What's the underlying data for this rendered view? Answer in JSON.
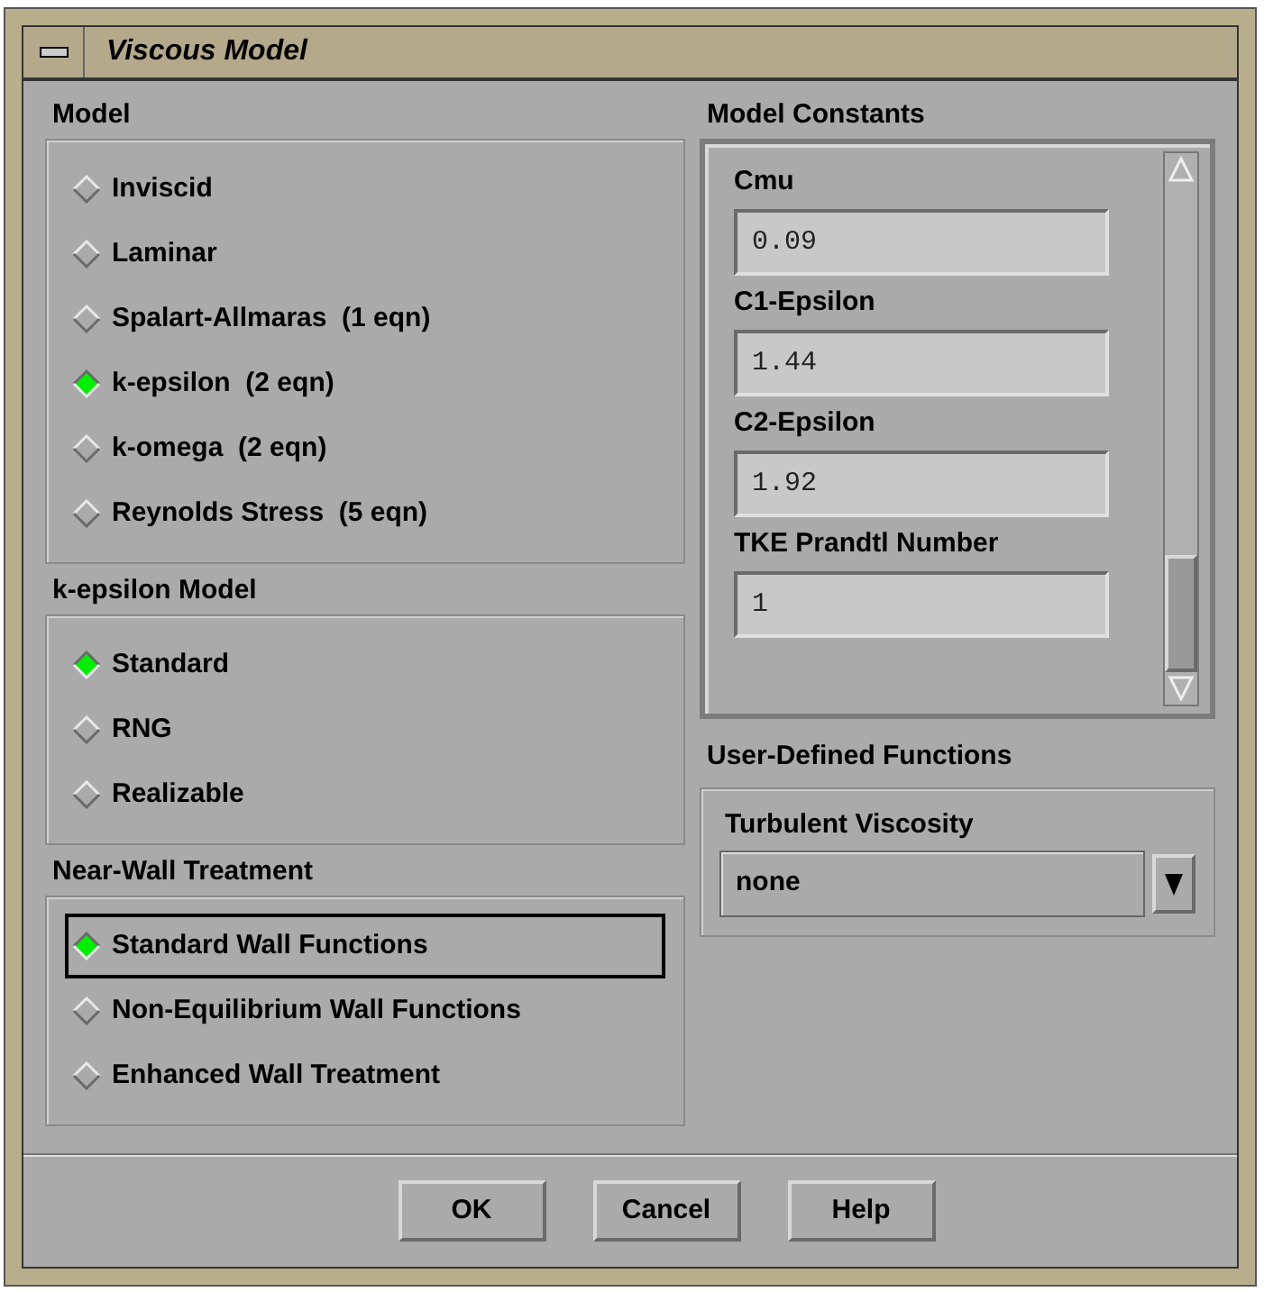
{
  "window": {
    "title": "Viscous Model"
  },
  "groups": [
    {
      "title": "Model",
      "items": [
        {
          "label": "Inviscid",
          "selected": false,
          "focused": false
        },
        {
          "label": "Laminar",
          "selected": false,
          "focused": false
        },
        {
          "label": "Spalart-Allmaras  (1 eqn)",
          "selected": false,
          "focused": false
        },
        {
          "label": "k-epsilon  (2 eqn)",
          "selected": true,
          "focused": false
        },
        {
          "label": "k-omega  (2 eqn)",
          "selected": false,
          "focused": false
        },
        {
          "label": "Reynolds Stress  (5 eqn)",
          "selected": false,
          "focused": false
        }
      ]
    },
    {
      "title": "k-epsilon Model",
      "items": [
        {
          "label": "Standard",
          "selected": true,
          "focused": false
        },
        {
          "label": "RNG",
          "selected": false,
          "focused": false
        },
        {
          "label": "Realizable",
          "selected": false,
          "focused": false
        }
      ]
    },
    {
      "title": "Near-Wall Treatment",
      "items": [
        {
          "label": "Standard Wall Functions",
          "selected": true,
          "focused": true
        },
        {
          "label": "Non-Equilibrium Wall Functions",
          "selected": false,
          "focused": false
        },
        {
          "label": "Enhanced Wall Treatment",
          "selected": false,
          "focused": false
        }
      ]
    }
  ],
  "model_constants": {
    "title": "Model Constants",
    "fields": [
      {
        "label": "Cmu",
        "value": "0.09"
      },
      {
        "label": "C1-Epsilon",
        "value": "1.44"
      },
      {
        "label": "C2-Epsilon",
        "value": "1.92"
      },
      {
        "label": "TKE Prandtl Number",
        "value": "1"
      }
    ]
  },
  "user_defined_functions": {
    "title": "User-Defined Functions",
    "label": "Turbulent Viscosity",
    "value": "none"
  },
  "buttons": [
    "OK",
    "Cancel",
    "Help"
  ]
}
